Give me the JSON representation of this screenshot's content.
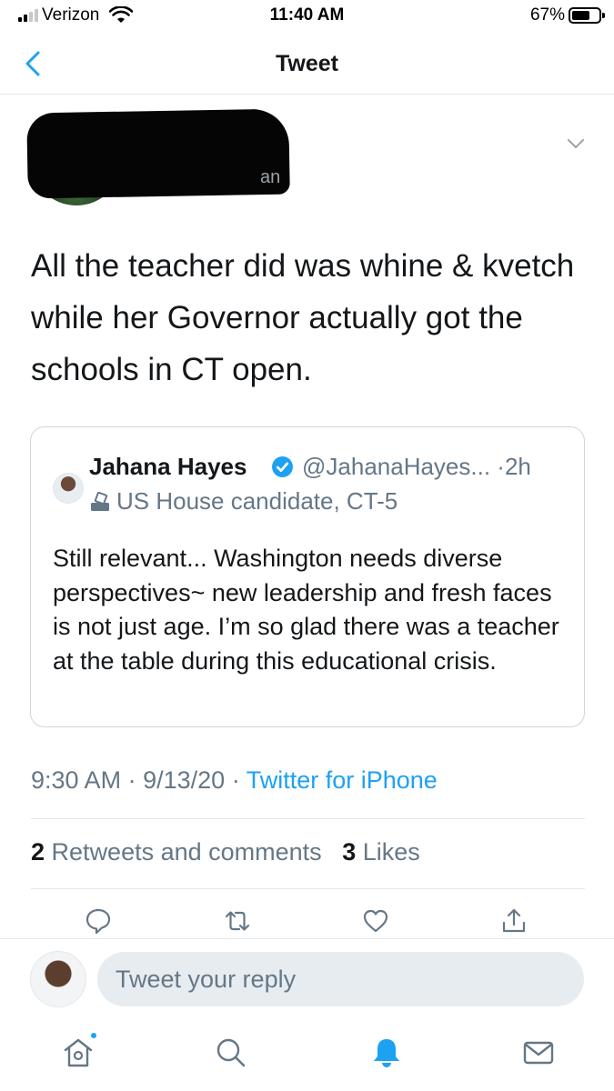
{
  "status_bar": {
    "carrier": "Verizon",
    "time": "11:40 AM",
    "battery": "67%",
    "battery_level": 0.67,
    "signal_bars": 2,
    "icons": [
      "signal-icon",
      "wifi-icon",
      "battery-icon"
    ]
  },
  "header": {
    "title": "Tweet",
    "back_icon": "chevron-left-icon"
  },
  "tweet": {
    "author": {
      "redacted": true,
      "visible_fragment": "an"
    },
    "text": "All the teacher did was whine & kvetch while her Governor actually got the schools in CT open.",
    "menu_icon": "chevron-down-icon",
    "quoted": {
      "name": "Jahana Hayes",
      "verified": true,
      "handle": "@JahanaHayes...",
      "separator": "·",
      "age": "2h",
      "label": "US House candidate, CT-5",
      "label_icon": "ballot-box-icon",
      "text": "Still relevant... Washington needs diverse perspectives~ new leadership and fresh faces is not just age. I’m so glad there was a teacher at the table during this educational crisis."
    },
    "meta": {
      "time": "9:30 AM",
      "sep1": "·",
      "date": "9/13/20",
      "sep2": "·",
      "source": "Twitter for iPhone"
    },
    "stats": {
      "retweets_count": "2",
      "retweets_label": "Retweets and comments",
      "likes_count": "3",
      "likes_label": "Likes"
    },
    "actions": [
      "reply-icon",
      "retweet-icon",
      "like-icon",
      "share-icon"
    ]
  },
  "reply": {
    "placeholder": "Tweet your reply"
  },
  "tab_bar": {
    "tabs": [
      "home-icon",
      "search-icon",
      "notifications-icon",
      "messages-icon"
    ],
    "active": "notifications-icon",
    "home_has_dot": true
  },
  "colors": {
    "accent": "#1da1f2",
    "text": "#14171a",
    "secondary": "#657786",
    "border": "#e1e8ed"
  }
}
